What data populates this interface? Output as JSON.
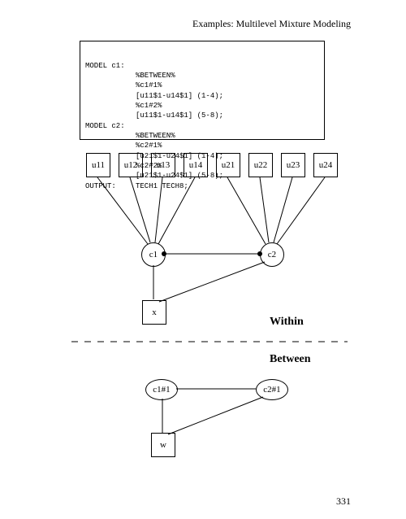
{
  "header": "Examples: Multilevel Mixture Modeling",
  "code": {
    "lines": [
      {
        "key": "MODEL c1:",
        "body": ""
      },
      {
        "key": "",
        "body": "%BETWEEN%"
      },
      {
        "key": "",
        "body": "%c1#1%"
      },
      {
        "key": "",
        "body": "[u11$1-u14$1] (1-4);"
      },
      {
        "key": "",
        "body": "%c1#2%"
      },
      {
        "key": "",
        "body": "[u11$1-u14$1] (5-8);"
      },
      {
        "key": "MODEL c2:",
        "body": ""
      },
      {
        "key": "",
        "body": "%BETWEEN%"
      },
      {
        "key": "",
        "body": "%c2#1%"
      },
      {
        "key": "",
        "body": "[u21$1-u24$1] (1-4);"
      },
      {
        "key": "",
        "body": "%c2#2%"
      },
      {
        "key": "",
        "body": "[u21$1-u24$1] (5-8);"
      },
      {
        "key": "OUTPUT:",
        "body": "TECH1 TECH8;"
      }
    ]
  },
  "figure": {
    "u_boxes": [
      "u11",
      "u12",
      "u13",
      "u14",
      "u21",
      "u22",
      "u23",
      "u24"
    ],
    "c1": "c1",
    "c2": "c2",
    "x": "x",
    "c1h": "c1#1",
    "c2h": "c2#1",
    "w": "w",
    "lbl_within": "Within",
    "lbl_between": "Between"
  },
  "pagenum": "331"
}
